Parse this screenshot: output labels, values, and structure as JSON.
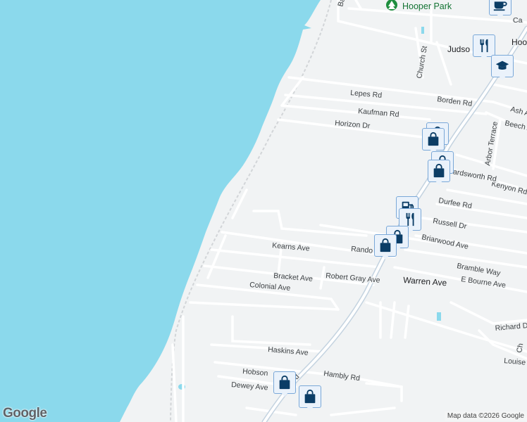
{
  "map": {
    "colors": {
      "water": "#8bd9ec",
      "land": "#f1f3f4",
      "road": "#ffffff",
      "highway": "#c4d3e0",
      "green": "#ceead6",
      "poi": "#0b3d66"
    },
    "water_color": "#8bd9ec",
    "road_labels": {
      "ba": "Ba",
      "ca": "Ca",
      "hoo": "Hoo",
      "judso": "Judso",
      "church": "Church St",
      "lepes": "Lepes Rd",
      "borden": "Borden Rd",
      "kaufman": "Kaufman Rd",
      "ash": "Ash A",
      "beech": "Beech A",
      "horizon": "Horizon Dr",
      "arbor": "Arbor Terrace",
      "kenyon": "Kenyon Rd",
      "beardsworth": "Beardsworth Rd",
      "durfee": "Durfee Rd",
      "russell": "Russell Dr",
      "briarwood": "Briarwood Ave",
      "kearns": "Kearns Ave",
      "rando": "Rando",
      "bramble": "Bramble Way",
      "ebourne": "E Bourne Ave",
      "bracket": "Bracket Ave",
      "robertgray": "Robert Gray Ave",
      "warren": "Warren Ave",
      "colonial": "Colonial Ave",
      "richard": "Richard D",
      "ch": "Ch",
      "haskins": "Haskins Ave",
      "louise": "Louise",
      "hobson": "Hobson",
      "hambly": "Hambly Rd",
      "dewey": "Dewey Ave",
      "d": "d"
    },
    "park_label": "Hooper Park",
    "park_icon": "tree-icon",
    "markers": [
      {
        "name": "coffee-marker",
        "icon": "coffee-cup-icon"
      },
      {
        "name": "restaurant-marker",
        "icon": "fork-knife-icon"
      },
      {
        "name": "school-marker",
        "icon": "graduation-cap-icon"
      },
      {
        "name": "shopping-marker",
        "icon": "shopping-bag-icon"
      },
      {
        "name": "shopping-marker",
        "icon": "shopping-bag-icon"
      },
      {
        "name": "shopping-marker",
        "icon": "shopping-bag-icon"
      },
      {
        "name": "gas-marker",
        "icon": "fuel-pump-icon"
      },
      {
        "name": "restaurant-marker",
        "icon": "fork-knife-icon"
      },
      {
        "name": "shopping-marker",
        "icon": "shopping-bag-icon"
      },
      {
        "name": "shopping-marker",
        "icon": "shopping-bag-icon"
      },
      {
        "name": "shopping-marker",
        "icon": "shopping-bag-icon"
      },
      {
        "name": "shopping-marker",
        "icon": "shopping-bag-icon"
      }
    ]
  },
  "footer": {
    "logo": "Google",
    "attribution": "Map data ©2026 Google"
  }
}
